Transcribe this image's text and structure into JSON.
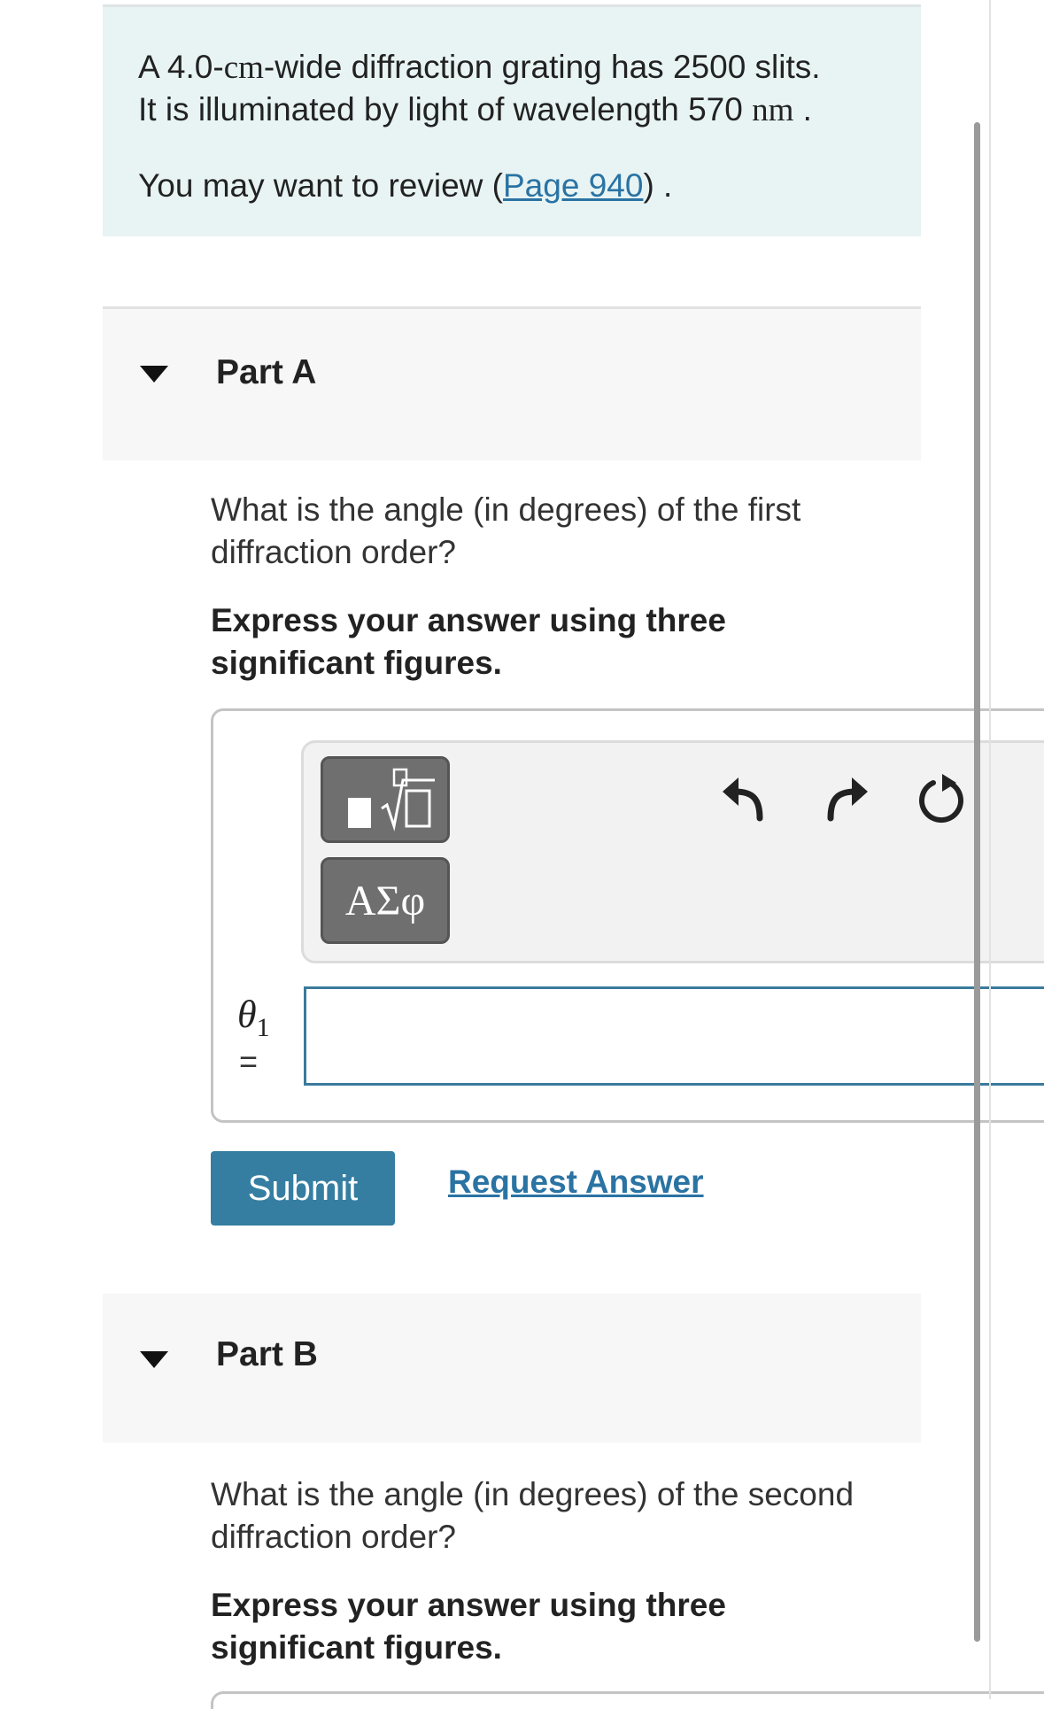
{
  "intro": {
    "line1_pre": "A 4.0-",
    "line1_unit": "cm",
    "line1_post": "-wide diffraction grating has 2500 slits.",
    "line2_pre": "It is illuminated by light of wavelength 570 ",
    "line2_unit": "nm",
    "line2_post": " .",
    "review_pre": "You may want to review (",
    "review_link": "Page 940",
    "review_post": ") ."
  },
  "partA": {
    "label": "Part A",
    "question": "What is the angle (in degrees) of the first diffraction order?",
    "instruction": "Express your answer using three significant figures.",
    "greek_label": "ΑΣφ",
    "variable": "θ",
    "variable_sub": "1",
    "equals": "=",
    "answer_value": "",
    "submit_label": "Submit",
    "request_label": "Request Answer"
  },
  "partB": {
    "label": "Part B",
    "question": "What is the angle (in degrees) of the second diffraction order?",
    "instruction": "Express your answer using three significant figures."
  },
  "icons": [
    "template-icon",
    "undo-icon",
    "redo-icon",
    "reset-icon"
  ],
  "colors": {
    "intro_bg": "#e8f4f4",
    "accent": "#357ea1",
    "link": "#2a73a3",
    "input_border": "#3a7a9c"
  }
}
